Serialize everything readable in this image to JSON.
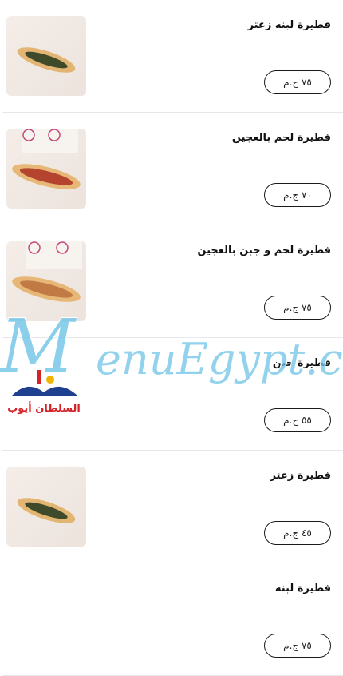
{
  "menu": {
    "items": [
      {
        "name": "فطيرة لبنه زعتر",
        "price": "٧٥ ج.م",
        "filling": "zaatar"
      },
      {
        "name": "فطيرة لحم بالعجين",
        "price": "٧٠ ج.م",
        "filling": "meat"
      },
      {
        "name": "فطيرة لحم و جبن بالعجين",
        "price": "٧٥ ج.م",
        "filling": "meat-cheese"
      },
      {
        "name": "فطيرة جبن",
        "price": "٥٥ ج.م",
        "filling": "cheese"
      },
      {
        "name": "فطيرة زعتر",
        "price": "٤٥ ج.م",
        "filling": "zaatar"
      },
      {
        "name": "فطيرة لبنه",
        "price": "٧٥ ج.م",
        "filling": "none"
      }
    ]
  },
  "watermark": {
    "text": "MenuEgypt.com"
  },
  "logo": {
    "text": "السلطان أيوب"
  },
  "colors": {
    "watermark": "#6ec3e6",
    "logo_red": "#d6232a",
    "logo_blue": "#1f3f8f"
  }
}
